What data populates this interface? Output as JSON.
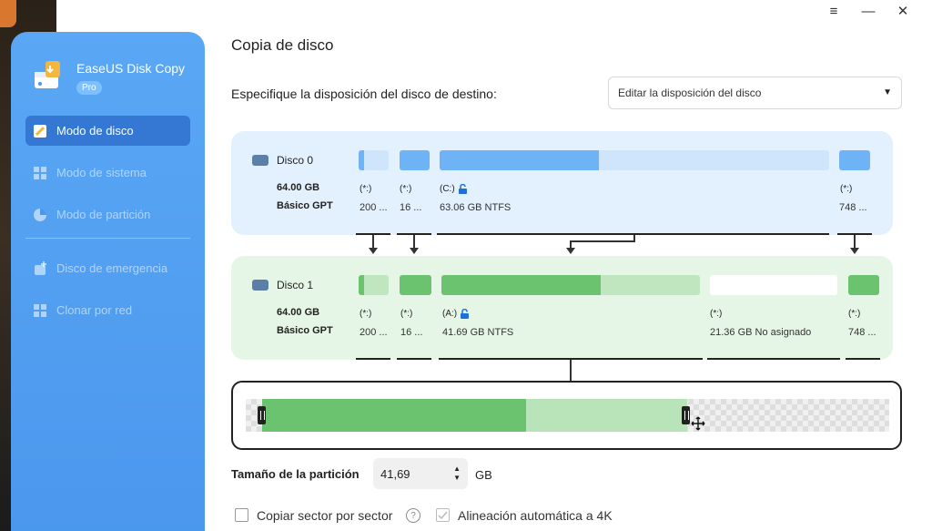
{
  "window": {
    "menu_icon": "≡",
    "minimize_icon": "—",
    "close_icon": "✕"
  },
  "sidebar": {
    "app_name": "EaseUS Disk Copy",
    "badge": "Pro",
    "items": [
      {
        "label": "Modo de disco",
        "icon": "disk-mode-icon",
        "active": true
      },
      {
        "label": "Modo de sistema",
        "icon": "windows-icon",
        "active": false
      },
      {
        "label": "Modo de partición",
        "icon": "pie-icon",
        "active": false
      },
      {
        "label": "Disco de emergencia",
        "icon": "emergency-disk-icon",
        "active": false
      },
      {
        "label": "Clonar por red",
        "icon": "network-clone-icon",
        "active": false
      }
    ]
  },
  "main": {
    "title": "Copia de disco",
    "layout_label": "Especifique la disposición del disco de destino:",
    "layout_select": "Editar la disposición del disco"
  },
  "disk0": {
    "name": "Disco 0",
    "size": "64.00 GB",
    "type": "Básico GPT",
    "partitions": [
      {
        "label": "(*:)",
        "detail": "200 ..."
      },
      {
        "label": "(*:)",
        "detail": "16 ..."
      },
      {
        "label": "(C:)",
        "detail": "63.06 GB NTFS"
      },
      {
        "label": "(*:)",
        "detail": "748 ..."
      }
    ]
  },
  "disk1": {
    "name": "Disco 1",
    "size": "64.00 GB",
    "type": "Básico GPT",
    "partitions": [
      {
        "label": "(*:)",
        "detail": "200 ..."
      },
      {
        "label": "(*:)",
        "detail": "16 ..."
      },
      {
        "label": "(A:)",
        "detail": "41.69 GB NTFS"
      },
      {
        "label": "(*:)",
        "detail": "21.36 GB No asignado"
      },
      {
        "label": "(*:)",
        "detail": "748 ..."
      }
    ]
  },
  "resize": {
    "size_label": "Tamaño de la partición",
    "size_value": "41,69",
    "unit": "GB"
  },
  "options": {
    "sector_copy": "Copiar sector por sector",
    "align_4k": "Alineación automática a 4K"
  },
  "colors": {
    "accent": "#4a97ee",
    "used_green": "#6cc36f",
    "used_blue": "#6fb3f7"
  }
}
